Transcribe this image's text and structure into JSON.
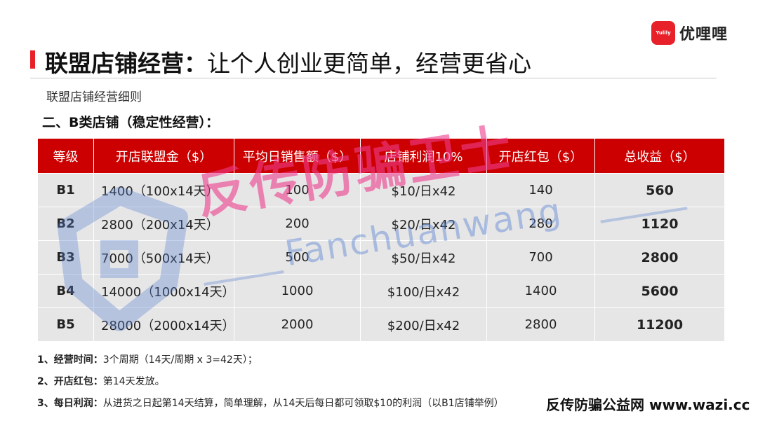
{
  "brand": {
    "badge": "Yulily",
    "name": "优哩哩"
  },
  "title": {
    "main": "联盟店铺经营：",
    "rest": "让个人创业更简单，经营更省心"
  },
  "subtitle": "联盟店铺经营细则",
  "section_heading": "二、B类店铺（稳定性经营）：",
  "table": {
    "headers": [
      "等级",
      "开店联盟金（$）",
      "平均日销售额（$）",
      "店铺利润10%",
      "开店红包（$）",
      "总收益（$）"
    ],
    "rows": [
      {
        "level": "B1",
        "fee": "1400（100x14天）",
        "daily_sales": "100",
        "profit": "$10/日x42",
        "bonus": "140",
        "total": "560"
      },
      {
        "level": "B2",
        "fee": "2800（200x14天）",
        "daily_sales": "200",
        "profit": "$20/日x42",
        "bonus": "280",
        "total": "1120"
      },
      {
        "level": "B3",
        "fee": "7000（500x14天）",
        "daily_sales": "500",
        "profit": "$50/日x42",
        "bonus": "700",
        "total": "2800"
      },
      {
        "level": "B4",
        "fee": "14000（1000x14天）",
        "daily_sales": "1000",
        "profit": "$100/日x42",
        "bonus": "1400",
        "total": "5600"
      },
      {
        "level": "B5",
        "fee": "28000（2000x14天）",
        "daily_sales": "2000",
        "profit": "$200/日x42",
        "bonus": "2800",
        "total": "11200"
      }
    ]
  },
  "notes": [
    {
      "label": "1、经营时间：",
      "text": "3个周期（14天/周期 x 3=42天）；"
    },
    {
      "label": "2、开店红包：",
      "text": "第14天发放。"
    },
    {
      "label": "3、每日利润：",
      "text": "从进货之日起第14天结算，简单理解，从14天后每日都可领取$10的利润（以B1店铺举例）"
    }
  ],
  "watermark": {
    "text": "反传防骗卫士",
    "pinyin": "Fanchuanwang",
    "site": "反传防骗公益网 www.wazi.cc"
  },
  "colors": {
    "accent": "#cc0000",
    "row_bg": "#e6e6e6",
    "watermark_pink": "#ec3c8c",
    "watermark_blue": "#5a82d2"
  }
}
